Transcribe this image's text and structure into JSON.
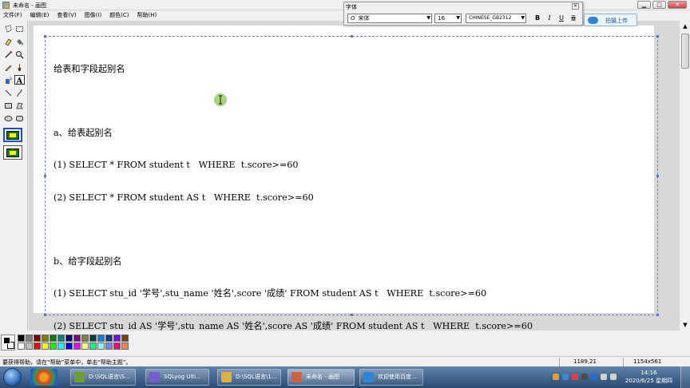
{
  "window": {
    "title": "未命名 - 画图",
    "buttons": {
      "minimize": "▁",
      "maximize": "□",
      "close": "✕"
    }
  },
  "menu": [
    "文件(F)",
    "编辑(E)",
    "查看(V)",
    "图像(I)",
    "颜色(C)",
    "帮助(H)"
  ],
  "font_toolbar": {
    "title": "字体",
    "font_name": "宋体",
    "font_size": "16",
    "charset": "CHINESE_GB2312",
    "bold": "B",
    "italic": "I",
    "underline": "U",
    "vertical": "垂"
  },
  "cloud_button": {
    "label": "拍摄上传",
    "icon": "cloud-upload-icon"
  },
  "canvas_text": {
    "lines": [
      "给表和字段起别名",
      "",
      "a、给表起别名",
      "(1) SELECT * FROM student t   WHERE  t.score>=60",
      "(2) SELECT * FROM student AS t   WHERE  t.score>=60",
      "",
      "b、给字段起别名",
      "(1) SELECT stu_id '学号',stu_name '姓名',score '成绩' FROM student AS t   WHERE  t.score>=60",
      "(2) SELECT stu_id AS '学号',stu_name AS '姓名',score AS '成绩' FROM student AS t   WHERE  t.score>=60"
    ]
  },
  "tools": [
    {
      "name": "free-select-icon",
      "glyph": "⬚"
    },
    {
      "name": "rect-select-icon",
      "glyph": "▭"
    },
    {
      "name": "eraser-icon",
      "glyph": "▰"
    },
    {
      "name": "fill-icon",
      "glyph": "◕"
    },
    {
      "name": "color-picker-icon",
      "glyph": "⟋"
    },
    {
      "name": "magnifier-icon",
      "glyph": "⚲"
    },
    {
      "name": "pencil-icon",
      "glyph": "✎"
    },
    {
      "name": "brush-icon",
      "glyph": "♙"
    },
    {
      "name": "airbrush-icon",
      "glyph": "♨"
    },
    {
      "name": "text-icon",
      "glyph": "A"
    },
    {
      "name": "line-icon",
      "glyph": "╲"
    },
    {
      "name": "curve-icon",
      "glyph": "∫"
    },
    {
      "name": "rectangle-icon",
      "glyph": "▭"
    },
    {
      "name": "polygon-icon",
      "glyph": "⏢"
    },
    {
      "name": "ellipse-icon",
      "glyph": "⬭"
    },
    {
      "name": "rounded-rect-icon",
      "glyph": "▢"
    }
  ],
  "palette": {
    "top": [
      "#000000",
      "#808080",
      "#800000",
      "#808000",
      "#008000",
      "#008080",
      "#000080",
      "#800080",
      "#808040",
      "#004040",
      "#0080ff",
      "#004080",
      "#8000ff",
      "#804000"
    ],
    "bottom": [
      "#ffffff",
      "#c0c0c0",
      "#ff0000",
      "#ffff00",
      "#00ff00",
      "#00ffff",
      "#0000ff",
      "#ff00ff",
      "#ffff80",
      "#00ff80",
      "#80ffff",
      "#8080ff",
      "#ff0080",
      "#ff8040"
    ]
  },
  "statusbar": {
    "help": "要获得帮助，请在“帮助”菜单中，单击“帮助主题”。",
    "coords": "1189,21",
    "size": "1154x561"
  },
  "taskbar": {
    "items": [
      {
        "label": "D:\\SQL语言\\S...",
        "icon_color": "#6aa030"
      },
      {
        "label": "SQLyog Ulti...",
        "icon_color": "#7a5ad0"
      },
      {
        "label": "D:\\SQL语言\\1...",
        "icon_color": "#e0b040"
      },
      {
        "label": "未命名 - 画图",
        "icon_color": "#d06040"
      },
      {
        "label": "欢迎使用百度...",
        "icon_color": "#2a86d8"
      }
    ],
    "time": "14:16",
    "date": "2020/6/25 星期四"
  }
}
